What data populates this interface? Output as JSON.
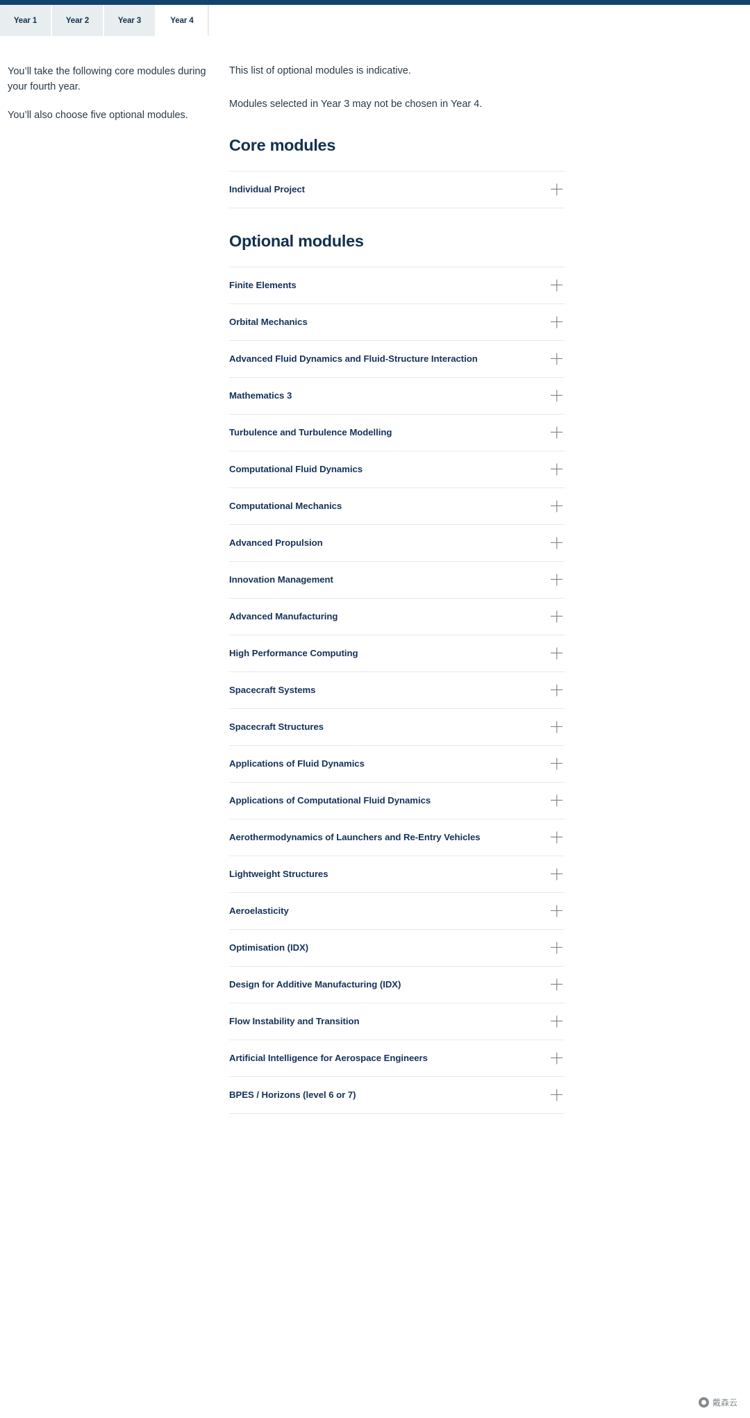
{
  "theme": {
    "brand_bar": "#12436b",
    "heading_color": "#12304d",
    "module_title_color": "#14325a",
    "tab_inactive_bg": "#e8edef",
    "rule_color": "#e7e9eb"
  },
  "tabs": [
    {
      "label": "Year 1",
      "active": false
    },
    {
      "label": "Year 2",
      "active": false
    },
    {
      "label": "Year 3",
      "active": false
    },
    {
      "label": "Year 4",
      "active": true
    }
  ],
  "left_column": {
    "paragraphs": [
      "You’ll take the following core modules during your fourth year.",
      "You’ll also choose five optional modules."
    ]
  },
  "right_column": {
    "intro": [
      "This list of optional modules is indicative.",
      "Modules selected in Year 3 may not be chosen in Year 4."
    ],
    "core_heading": "Core modules",
    "core_modules": [
      "Individual Project"
    ],
    "optional_heading": "Optional modules",
    "optional_modules": [
      "Finite Elements",
      "Orbital Mechanics",
      "Advanced Fluid Dynamics and Fluid-Structure Interaction",
      "Mathematics 3",
      "Turbulence and Turbulence Modelling",
      "Computational Fluid Dynamics",
      "Computational Mechanics",
      "Advanced Propulsion",
      "Innovation Management",
      "Advanced Manufacturing",
      "High Performance Computing",
      "Spacecraft Systems",
      "Spacecraft Structures",
      "Applications of Fluid Dynamics",
      "Applications of Computational Fluid Dynamics",
      "Aerothermodynamics of Launchers and Re-Entry Vehicles",
      "Lightweight Structures",
      "Aeroelasticity",
      "Optimisation (IDX)",
      "Design for Additive Manufacturing (IDX)",
      "Flow Instability and Transition",
      "Artificial Intelligence for Aerospace Engineers",
      "BPES / Horizons (level 6 or 7)"
    ],
    "expand_icon": "plus-icon"
  },
  "watermark": {
    "text": "戴森云",
    "icon": "circle-logo-icon"
  }
}
